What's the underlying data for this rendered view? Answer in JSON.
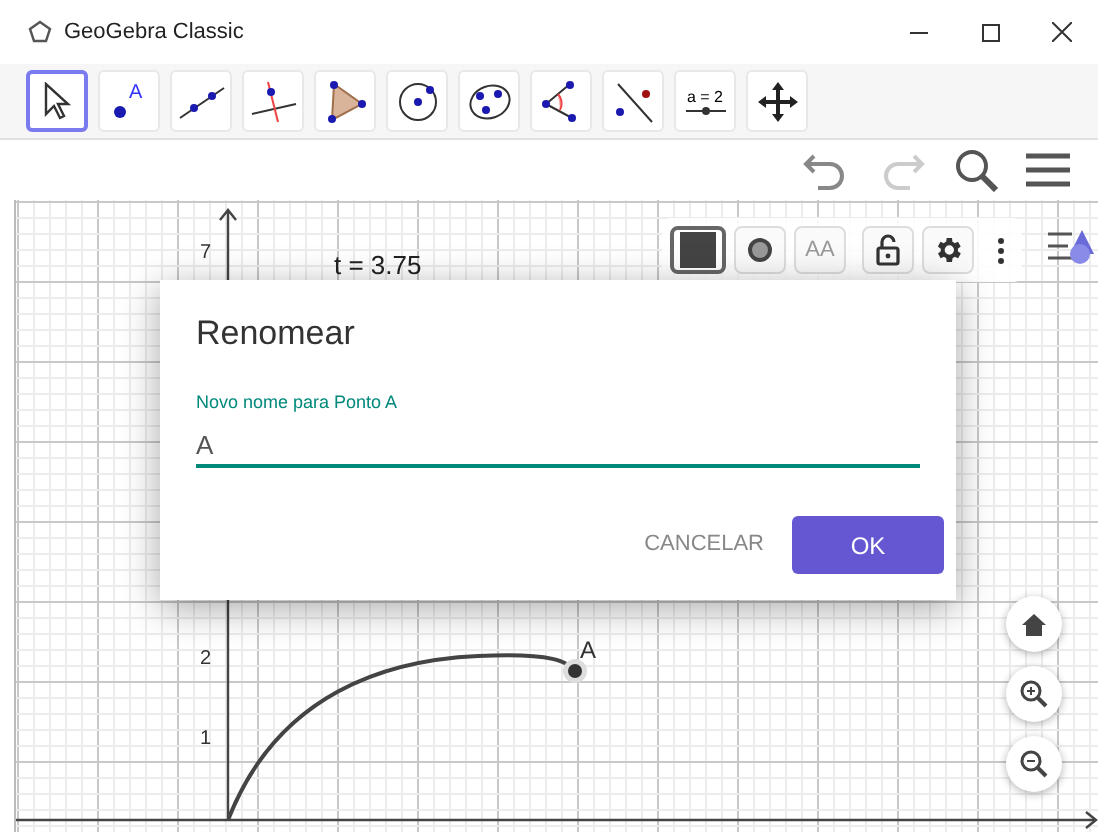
{
  "window": {
    "title": "GeoGebra Classic"
  },
  "toolbar": {
    "tools": [
      {
        "selected": true
      },
      {
        "selected": false,
        "point_label": "A"
      },
      {
        "selected": false
      },
      {
        "selected": false
      },
      {
        "selected": false
      },
      {
        "selected": false
      },
      {
        "selected": false
      },
      {
        "selected": false
      },
      {
        "selected": false
      },
      {
        "selected": false,
        "label": "a = 2"
      },
      {
        "selected": false
      }
    ]
  },
  "graphics": {
    "y_axis_labels": [
      "7",
      "2",
      "1"
    ],
    "text": "t = 3.75",
    "point_label": "A",
    "style_bar": [
      {
        "kind": "color",
        "selected": true
      },
      {
        "kind": "point",
        "selected": false
      },
      {
        "kind": "text",
        "label": "AA",
        "selected": false
      },
      {
        "kind": "lock",
        "selected": false
      },
      {
        "kind": "settings",
        "selected": false
      },
      {
        "kind": "more",
        "selected": false
      }
    ]
  },
  "dialog": {
    "title": "Renomear",
    "field_label": "Novo nome para Ponto A",
    "value": "A",
    "buttons": [
      {
        "kind": "text",
        "label": "CANCELAR"
      },
      {
        "kind": "primary",
        "label": "OK"
      }
    ]
  }
}
